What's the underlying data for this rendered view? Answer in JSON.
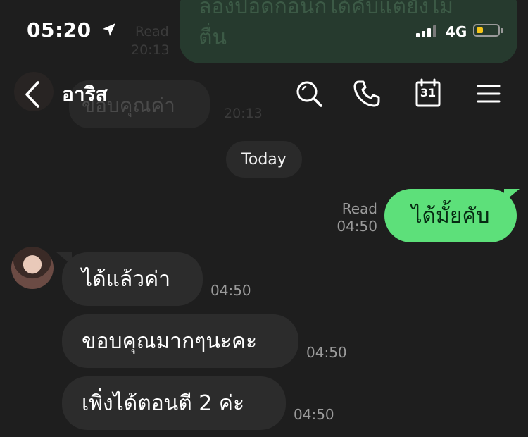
{
  "status_bar": {
    "time": "05:20",
    "network": "4G"
  },
  "background_messages": {
    "read_label": "Read",
    "read_time": "20:13",
    "outgoing_text_line1": "ลองปอดก่อนก็ได้คับแต่ยังไม่",
    "outgoing_text_line2": "ตื่น",
    "incoming_text": "ขอบคุณค่า",
    "incoming_time": "20:13"
  },
  "header": {
    "contact_name": "อาริส",
    "calendar_day": "31",
    "icons": [
      "back-icon",
      "search-icon",
      "phone-icon",
      "calendar-icon",
      "menu-icon"
    ]
  },
  "chat": {
    "date_label": "Today",
    "outgoing": {
      "read_label": "Read",
      "time": "04:50",
      "text": "ได้มั้ยคับ"
    },
    "incoming": [
      {
        "text": "ได้แล้วค่า",
        "time": "04:50"
      },
      {
        "text": "ขอบคุณมากๆนะคะ",
        "time": "04:50"
      },
      {
        "text": "เพิ่งได้ตอนตี 2 ค่ะ",
        "time": "04:50"
      }
    ]
  },
  "colors": {
    "background": "#1e1e1e",
    "outgoing_bubble": "#5de07a",
    "incoming_bubble": "#2c2c2c",
    "battery_level": "#f5c518"
  }
}
